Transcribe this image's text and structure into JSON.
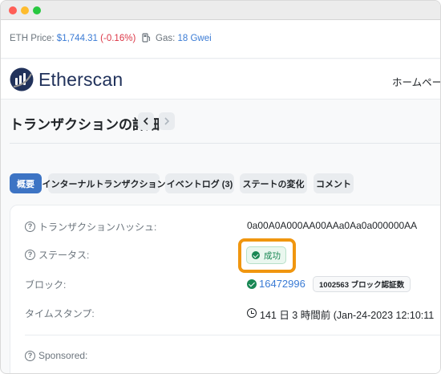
{
  "topbar": {
    "eth_label": "ETH Price:",
    "eth_price": "$1,744.31",
    "eth_change": "(-0.16%)",
    "gas_label": "Gas:",
    "gas_value": "18 Gwei"
  },
  "header": {
    "logo_text": "Etherscan",
    "nav_home": "ホームページ"
  },
  "page": {
    "title": "トランザクションの詳細"
  },
  "tabs": [
    {
      "label": "概要",
      "active": true
    },
    {
      "label": "インターナルトランザクション",
      "active": false
    },
    {
      "label": "イベントログ (3)",
      "active": false
    },
    {
      "label": "ステートの変化",
      "active": false
    },
    {
      "label": "コメント",
      "active": false
    }
  ],
  "details": {
    "hash_label": "トランザクションハッシュ:",
    "hash_value": "0a00A0A000AA00AAa0Aa0a000000AA",
    "status_label": "ステータス:",
    "status_value": "成功",
    "block_label": "ブロック:",
    "block_value": "16472996",
    "block_confirmations": "1002563 ブロック認証数",
    "timestamp_label": "タイムスタンプ:",
    "timestamp_value": "141 日 3 時間前 (Jan-24-2023 12:10:11",
    "sponsored_label": "Sponsored:"
  },
  "colors": {
    "accent": "#3d74c4",
    "link": "#3a7bd5",
    "success": "#198754",
    "negative": "#dc3545",
    "highlight": "#f0960f"
  }
}
